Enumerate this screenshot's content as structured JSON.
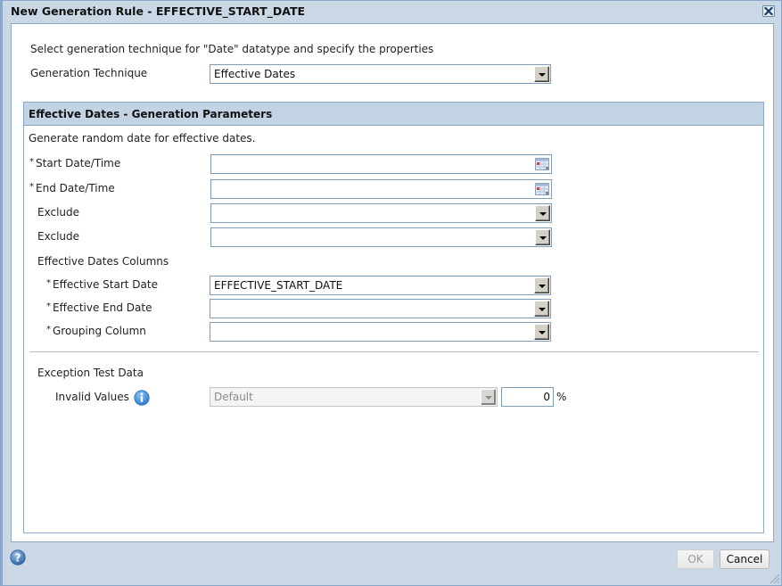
{
  "dialog": {
    "title": "New Generation Rule - EFFECTIVE_START_DATE",
    "close_icon": "close-icon"
  },
  "intro": {
    "instruction": "Select generation technique for \"Date\" datatype and specify the properties",
    "technique_label": "Generation Technique",
    "technique_value": "Effective Dates"
  },
  "panel": {
    "title": "Effective Dates - Generation Parameters",
    "description": "Generate random date for effective dates.",
    "required_marker": "*",
    "start_datetime": {
      "label": "Start Date/Time",
      "value": "",
      "required": true,
      "icon": "calendar-icon"
    },
    "end_datetime": {
      "label": "End Date/Time",
      "value": "",
      "required": true,
      "icon": "calendar-icon"
    },
    "exclude_1": {
      "label": "Exclude",
      "value": ""
    },
    "exclude_2": {
      "label": "Exclude",
      "value": ""
    },
    "columns_heading": "Effective Dates Columns",
    "effective_start": {
      "label": "Effective Start Date",
      "value": "EFFECTIVE_START_DATE",
      "required": true
    },
    "effective_end": {
      "label": "Effective End Date",
      "value": "",
      "required": true
    },
    "grouping": {
      "label": "Grouping Column",
      "value": "",
      "required": true
    },
    "exception_heading": "Exception Test Data",
    "invalid_values": {
      "label": "Invalid Values",
      "icon": "info-icon",
      "select_value": "Default",
      "select_disabled": true,
      "percent_value": "0",
      "percent_unit": "%"
    }
  },
  "footer": {
    "help_icon": "help-icon",
    "ok_label": "OK",
    "ok_disabled": true,
    "cancel_label": "Cancel"
  },
  "colors": {
    "frame_bg": "#cad8e6",
    "panel_header_bg": "#c2d3e3",
    "border": "#8ea8c6",
    "input_border": "#7f9db9"
  }
}
